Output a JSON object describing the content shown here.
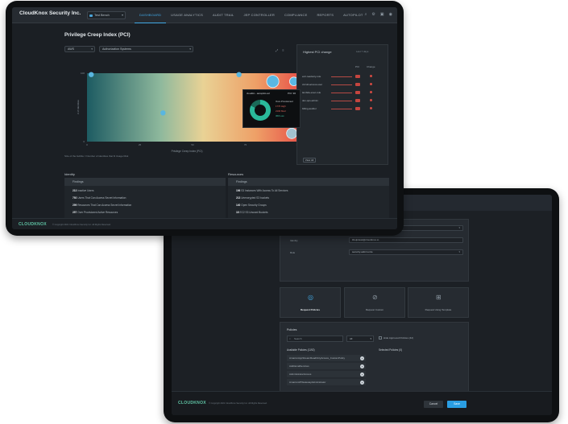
{
  "front": {
    "brand": "CloudKnox Security Inc.",
    "org_select": "Test Bench",
    "nav": [
      "Dashboard",
      "Usage Analytics",
      "Audit Trail",
      "JEP Controller",
      "Compliance",
      "Reports",
      "Autopilot"
    ],
    "pci_title": "Privilege Creep Index (PCI)",
    "filter_provider": "AWS",
    "filter_account": "Authorization Systems",
    "chart_note": "Size of the bubble = Number of identities that fit Usage Risk",
    "right_panel": {
      "title": "Highest PCI change",
      "subtitle": "Last 7 days",
      "col_pci": "PCI",
      "col_change": "Change",
      "rows": [
        "ec2-readonly-role",
        "s3-full-access-user",
        "lambda-exec-role",
        "dev-ops-admin",
        "billing-auditor"
      ],
      "button": "View All"
    },
    "popup": {
      "title": "cloudkn...autopilot-ad",
      "pci": "PCI: 96",
      "lines": [
        "Over-Provisioned",
        "1770 High",
        "2100 Med",
        "360 Low"
      ]
    },
    "identity": {
      "label": "Identity",
      "header": "Findings",
      "rows": [
        {
          "count": "213",
          "text": "Inactive Users"
        },
        {
          "count": "792",
          "text": "Users That Can Access Secret Information"
        },
        {
          "count": "299",
          "text": "Resources That Can Access Secret Information"
        },
        {
          "count": "257",
          "text": "Over Provisioned Active Resources"
        }
      ]
    },
    "resources": {
      "label": "Resources",
      "header": "Findings",
      "rows": [
        {
          "count": "196",
          "text": "S3 Instances With Access To All Services"
        },
        {
          "count": "213",
          "text": "Unencrypted S3 buckets"
        },
        {
          "count": "140",
          "text": "Open Security Groups"
        },
        {
          "count": "18",
          "text": "EC2 S3 Unused Buckets"
        }
      ]
    },
    "footer_logo": "CLOUDKNOX",
    "footer_copy": "© Copyright 2021 CloudKnox Security Inc. All Rights Reserved."
  },
  "back": {
    "form": {
      "label1": "Authorization System",
      "value1": "AWS-Accounts-Development",
      "label2": "Identity",
      "value2": "ithelpdesk@cloudknox.io",
      "label3": "Role",
      "value3": "security-admin-role"
    },
    "cards": [
      "Request Policies",
      "Request Custom",
      "Request Using Template"
    ],
    "policies": {
      "title": "Policies",
      "search_placeholder": "Search",
      "filter": "All",
      "checkbox": "Hide Approved Policies (42)",
      "available": "Available Policies (1192)",
      "selected": "Selected Policies (0)",
      "items": [
        "AmazonAppStreamReadOnlyAccess_CustomPolicy",
        "AdditionalServices",
        "AdministratorAccess",
        "AmazonAPIGatewayAdministrator"
      ]
    },
    "buttons": {
      "cancel": "Cancel",
      "save": "Save"
    },
    "footer_logo": "CLOUDKNOX",
    "footer_copy": "© Copyright 2021 CloudKnox Security Inc. All Rights Reserved."
  },
  "chart_data": {
    "type": "scatter",
    "title": "Privilege Creep Index (PCI)",
    "xlabel": "Privilege Creep Index (PCI)",
    "ylabel": "# of Identities",
    "x_ticks": [
      "0",
      "25",
      "50",
      "75",
      "100"
    ],
    "y_ticks": [
      "0",
      "100"
    ],
    "xlim": [
      0,
      100
    ],
    "ylim": [
      0,
      100
    ],
    "points": [
      {
        "x": 2,
        "y": 98,
        "size": 2,
        "color": "#59b6e0"
      },
      {
        "x": 36,
        "y": 42,
        "size": 2,
        "color": "#59b6e0"
      },
      {
        "x": 72,
        "y": 98,
        "size": 2,
        "color": "#59b6e0"
      },
      {
        "x": 88,
        "y": 88,
        "size": 6,
        "color": "#5ab7e3"
      },
      {
        "x": 98,
        "y": 88,
        "size": 4,
        "color": "#5ab7e3"
      },
      {
        "x": 97,
        "y": 12,
        "size": 5,
        "color": "#a3c2cf"
      }
    ]
  }
}
